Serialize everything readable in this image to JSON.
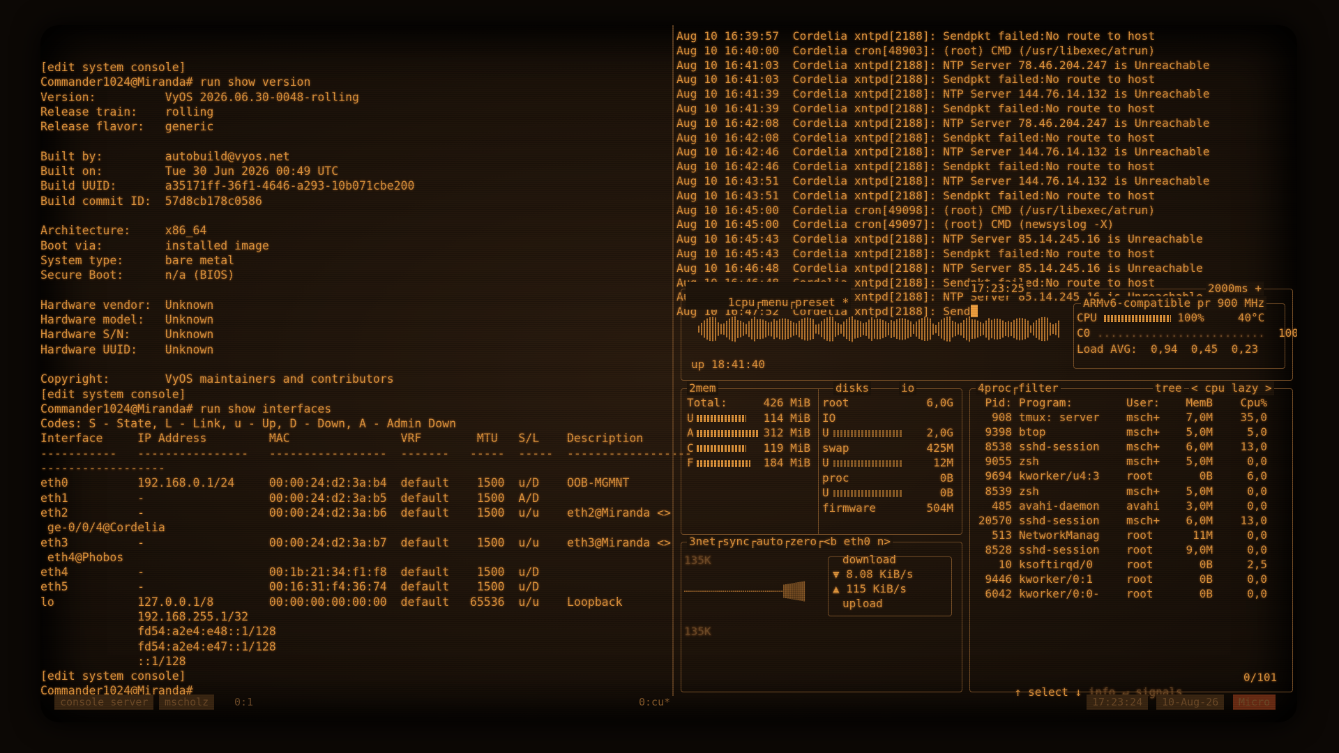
{
  "left_terminal": {
    "lines": [
      "[edit system console]",
      "Commander1024@Miranda# run show version",
      "Version:          VyOS 2026.06.30-0048-rolling",
      "Release train:    rolling",
      "Release flavor:   generic",
      "",
      "Built by:         autobuild@vyos.net",
      "Built on:         Tue 30 Jun 2026 00:49 UTC",
      "Build UUID:       a35171ff-36f1-4646-a293-10b071cbe200",
      "Build commit ID:  57d8cb178c0586",
      "",
      "Architecture:     x86_64",
      "Boot via:         installed image",
      "System type:      bare metal",
      "Secure Boot:      n/a (BIOS)",
      "",
      "Hardware vendor:  Unknown",
      "Hardware model:   Unknown",
      "Hardware S/N:     Unknown",
      "Hardware UUID:    Unknown",
      "",
      "Copyright:        VyOS maintainers and contributors",
      "[edit system console]",
      "Commander1024@Miranda# run show interfaces",
      "Codes: S - State, L - Link, u - Up, D - Down, A - Admin Down",
      "Interface     IP Address         MAC                VRF        MTU   S/L    Description",
      "-----------   ----------------   -----------------  -------   -----  -----  ------------------",
      "------------------",
      "eth0          192.168.0.1/24     00:00:24:d2:3a:b4  default    1500  u/D    OOB-MGMNT",
      "eth1          -                  00:00:24:d2:3a:b5  default    1500  A/D",
      "eth2          -                  00:00:24:d2:3a:b6  default    1500  u/u    eth2@Miranda <>",
      " ge-0/0/4@Cordelia",
      "eth3          -                  00:00:24:d2:3a:b7  default    1500  u/u    eth3@Miranda <>",
      " eth4@Phobos",
      "eth4          -                  00:1b:21:34:f1:f8  default    1500  u/D",
      "eth5          -                  00:16:31:f4:36:74  default    1500  u/D",
      "lo            127.0.0.1/8        00:00:00:00:00:00  default   65536  u/u    Loopback",
      "              192.168.255.1/32",
      "              fd54:a2e4:e48::1/128",
      "              fd54:a2e4:e47::1/128",
      "              ::1/128",
      "[edit system console]",
      "Commander1024@Miranda#"
    ]
  },
  "log": {
    "lines": [
      "Aug 10 16:39:57  Cordelia xntpd[2188]: Sendpkt failed:No route to host",
      "Aug 10 16:40:00  Cordelia cron[48903]: (root) CMD (/usr/libexec/atrun)",
      "Aug 10 16:41:03  Cordelia xntpd[2188]: NTP Server 78.46.204.247 is Unreachable",
      "Aug 10 16:41:03  Cordelia xntpd[2188]: Sendpkt failed:No route to host",
      "Aug 10 16:41:39  Cordelia xntpd[2188]: NTP Server 144.76.14.132 is Unreachable",
      "Aug 10 16:41:39  Cordelia xntpd[2188]: Sendpkt failed:No route to host",
      "Aug 10 16:42:08  Cordelia xntpd[2188]: NTP Server 78.46.204.247 is Unreachable",
      "Aug 10 16:42:08  Cordelia xntpd[2188]: Sendpkt failed:No route to host",
      "Aug 10 16:42:46  Cordelia xntpd[2188]: NTP Server 144.76.14.132 is Unreachable",
      "Aug 10 16:42:46  Cordelia xntpd[2188]: Sendpkt failed:No route to host",
      "Aug 10 16:43:51  Cordelia xntpd[2188]: NTP Server 144.76.14.132 is Unreachable",
      "Aug 10 16:43:51  Cordelia xntpd[2188]: Sendpkt failed:No route to host",
      "Aug 10 16:45:00  Cordelia cron[49098]: (root) CMD (/usr/libexec/atrun)",
      "Aug 10 16:45:00  Cordelia cron[49097]: (root) CMD (newsyslog -X)",
      "Aug 10 16:45:43  Cordelia xntpd[2188]: NTP Server 85.14.245.16 is Unreachable",
      "Aug 10 16:45:43  Cordelia xntpd[2188]: Sendpkt failed:No route to host",
      "Aug 10 16:46:48  Cordelia xntpd[2188]: NTP Server 85.14.245.16 is Unreachable",
      "Aug 10 16:46:48  Cordelia xntpd[2188]: Sendpkt failed:No route to host",
      "Aug 10 16:47:52  Cordelia xntpd[2188]: NTP Server 85.14.245.16 is Unreachable"
    ],
    "last_line": "Aug 10 16:47:52  Cordelia xntpd[2188]: Send"
  },
  "cpu_box": {
    "tabs": [
      "1cpu",
      "menu",
      "preset *"
    ],
    "clock": "17:23:25",
    "interval": "2000ms +",
    "model": "ARMv6-compatible pr",
    "freq": "900 MHz",
    "cpu_label": "CPU",
    "cpu_pct": "100%",
    "cpu_temp": "40°C",
    "cpu_fill": 1.0,
    "c0_label": "C0",
    "c0_pct": "100%",
    "load_label": "Load AVG:",
    "load1": "0,94",
    "load5": "0,45",
    "load15": "0,23",
    "uptime": "up 18:41:40"
  },
  "mem_box": {
    "title": "2mem",
    "disks_title": "disks",
    "io_title": "io",
    "rows": [
      {
        "k": "Total:",
        "v": "426 MiB",
        "fill": 0
      },
      {
        "k": "U",
        "v": "114 MiB",
        "fill": 0.27
      },
      {
        "k": "A",
        "v": "312 MiB",
        "fill": 0.73
      },
      {
        "k": "C",
        "v": "119 MiB",
        "fill": 0.28
      },
      {
        "k": "F",
        "v": "184 MiB",
        "fill": 0.43
      }
    ],
    "disks": [
      {
        "name": "root",
        "size": "6,0G"
      },
      {
        "name": "IO",
        "size": ""
      },
      {
        "name": "U",
        "size": "2,0G"
      },
      {
        "name": "swap",
        "size": "425M"
      },
      {
        "name": "U",
        "size": "12M"
      },
      {
        "name": "proc",
        "size": "0B"
      },
      {
        "name": "U",
        "size": "0B"
      },
      {
        "name": "firmware",
        "size": "504M"
      }
    ]
  },
  "net_box": {
    "title": "3net",
    "tabs": [
      "sync",
      "auto",
      "zero",
      "<b eth0 n>"
    ],
    "scale_top": "135K",
    "scale_bottom": "135K",
    "download_label": "download",
    "download_rate": "▼ 8.08 KiB/s",
    "upload_rate": "▲ 115 KiB/s",
    "upload_label": "upload"
  },
  "proc_box": {
    "title": "4proc",
    "filter": "filter",
    "tree": "tree",
    "sort": "< cpu lazy >",
    "headers": [
      "Pid:",
      "Program:",
      "User:",
      "MemB",
      "Cpu%"
    ],
    "rows": [
      [
        "908",
        "tmux: server",
        "msch+",
        "7,0M",
        "35,0"
      ],
      [
        "9398",
        "btop",
        "msch+",
        "5,0M",
        "5,0"
      ],
      [
        "8538",
        "sshd-session",
        "msch+",
        "6,0M",
        "13,0"
      ],
      [
        "9055",
        "zsh",
        "msch+",
        "5,0M",
        "0,0"
      ],
      [
        "9694",
        "kworker/u4:3",
        "root",
        "0B",
        "6,0"
      ],
      [
        "8539",
        "zsh",
        "msch+",
        "5,0M",
        "0,0"
      ],
      [
        "485",
        "avahi-daemon",
        "avahi",
        "3,0M",
        "0,0"
      ],
      [
        "20570",
        "sshd-session",
        "msch+",
        "6,0M",
        "13,0"
      ],
      [
        "513",
        "NetworkManag",
        "root",
        "11M",
        "0,0"
      ],
      [
        "8528",
        "sshd-session",
        "root",
        "9,0M",
        "0,0"
      ],
      [
        "10",
        "ksoftirqd/0",
        "root",
        "0B",
        "2,5"
      ],
      [
        "9446",
        "kworker/0:1",
        "root",
        "0B",
        "0,0"
      ],
      [
        "6042",
        "kworker/0:0-",
        "root",
        "0B",
        "0,0"
      ]
    ],
    "footer_select": "↑ select ↓",
    "footer_info": "info ↵",
    "footer_signals": "signals",
    "count": "0/101"
  },
  "tmux_bar": {
    "session": "console server",
    "user": "mscholz",
    "pane": "0:1",
    "window": "0:cu*",
    "time": "17:23:24",
    "date": "10-Aug-26",
    "host": "Micro"
  },
  "colors": {
    "amber": "#e0953c",
    "bg": "#1f150b"
  }
}
